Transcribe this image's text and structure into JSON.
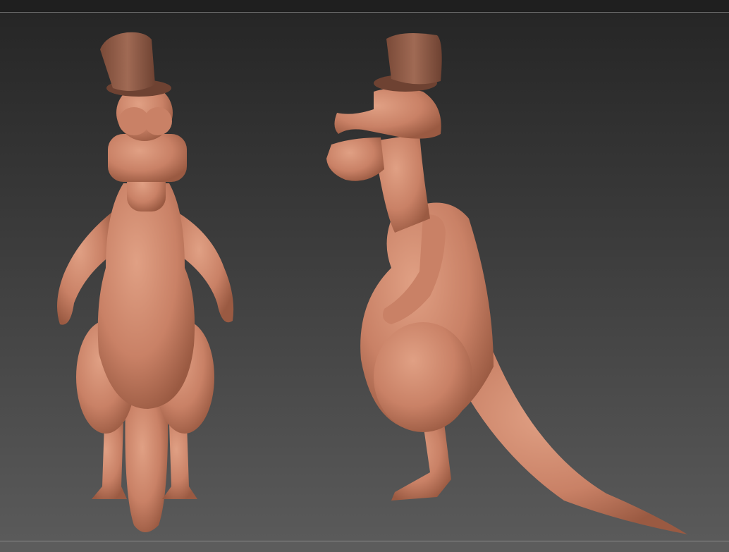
{
  "colors": {
    "skin": "#cf8a6e",
    "skin_shadow": "#9a5a42",
    "hat": "#8d5a46",
    "background_top": "#262626",
    "background_bottom": "#5a5a5a"
  },
  "icons": [
    "dinosaur-front-view-model",
    "dinosaur-side-view-model"
  ]
}
